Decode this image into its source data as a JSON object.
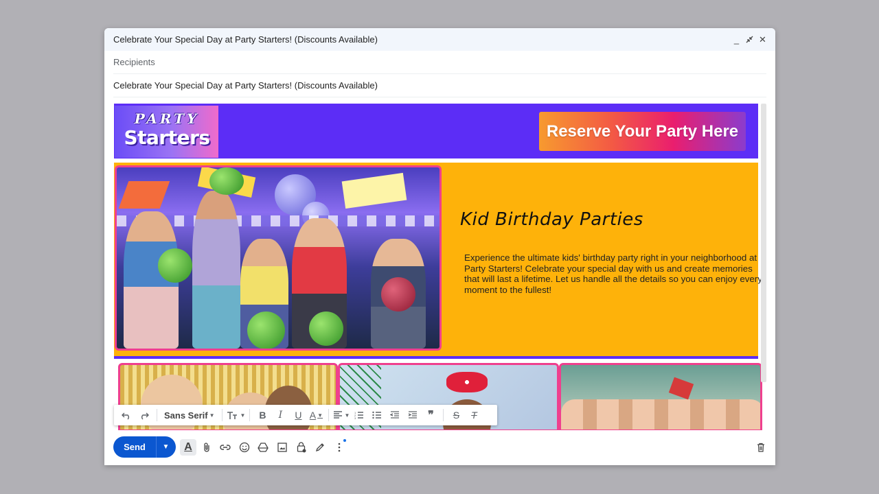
{
  "window": {
    "title": "Celebrate Your Special Day at Party Starters! (Discounts Available)",
    "controls": {
      "minimize": "minimize-icon",
      "popout": "exit-fullscreen-icon",
      "close": "close-icon"
    }
  },
  "recipients": {
    "placeholder": "Recipients"
  },
  "subject": {
    "value": "Celebrate Your Special Day at Party Starters!  (Discounts Available)"
  },
  "email": {
    "logo_line1": "PARTY",
    "logo_line2": "Starters",
    "reserve_button": "Reserve Your Party Here",
    "hero_title": "Kid Birthday Parties",
    "hero_text": "Experience the ultimate kids' birthday party right in your neighborhood at Party Starters! Celebrate your special day with us and create memories that will last a lifetime. Let us handle all the details so you can enjoy every moment to the fullest!",
    "colors": {
      "brand_purple": "#5c2df6",
      "hero_yellow": "#feb20a",
      "accent_pink": "#ef3f8e"
    }
  },
  "format_toolbar": {
    "font": "Sans Serif",
    "icons": [
      "undo-icon",
      "redo-icon",
      "font-size-icon",
      "bold-icon",
      "italic-icon",
      "underline-icon",
      "text-color-icon",
      "align-icon",
      "numbered-list-icon",
      "bulleted-list-icon",
      "indent-less-icon",
      "indent-more-icon",
      "quote-icon",
      "strikethrough-icon",
      "remove-formatting-icon"
    ]
  },
  "bottom_toolbar": {
    "send": "Send",
    "icons": [
      "formatting-options-icon",
      "attach-icon",
      "link-icon",
      "emoji-icon",
      "drive-icon",
      "photo-icon",
      "confidential-mode-icon",
      "signature-icon",
      "more-options-icon",
      "discard-icon"
    ]
  }
}
